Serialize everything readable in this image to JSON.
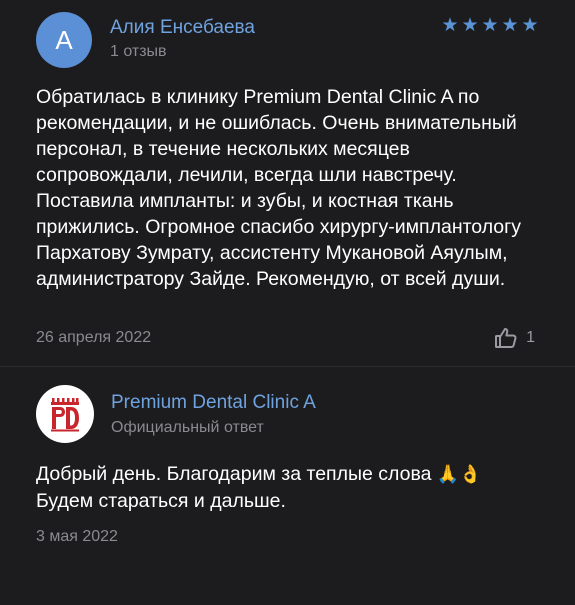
{
  "review": {
    "avatar_letter": "А",
    "author_name": "Алия Енсебаева",
    "author_meta": "1 отзыв",
    "rating": 5,
    "rating_stars": [
      "★",
      "★",
      "★",
      "★",
      "★"
    ],
    "text": "Обратилась в клинику Premium Dental Clinic A по рекомендации, и не ошиблась. Очень внимательный персонал, в течение нескольких месяцев сопровождали, лечили, всегда шли навстречу. Поставила импланты: и зубы, и костная ткань прижились. Огромное спасибо хирургу-имплантологу Пархатову Зумрату, ассистенту Мукановой Аяулым, администратору Зайде. Рекомендую, от всей души.",
    "date": "26 апреля 2022",
    "likes": "1"
  },
  "reply": {
    "clinic_name": "Premium Dental Clinic A",
    "meta": "Официальный ответ",
    "text_line1": "Добрый день. Благодарим за теплые слова",
    "emoji": "🙏👌",
    "text_line2": "Будем стараться и дальше.",
    "date": "3 мая 2022"
  },
  "colors": {
    "background": "#1c1c1e",
    "accent": "#6fa3df",
    "star": "#5a93d6",
    "muted": "#8a8a8f",
    "logo_red": "#c8262c"
  },
  "icons": {
    "like": "thumbs-up-icon",
    "logo": "clinic-logo-icon"
  }
}
